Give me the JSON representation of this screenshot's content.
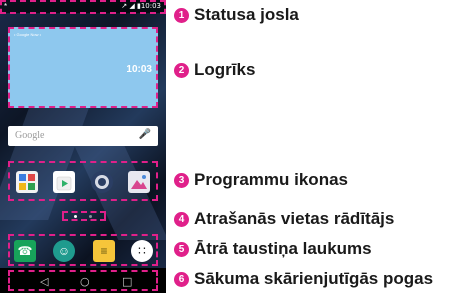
{
  "status_bar": {
    "left_icon": "*",
    "right_text": "↗ ◢ ▮10:03"
  },
  "widget": {
    "small_text": "• Google Now •",
    "time": "10:03"
  },
  "search": {
    "placeholder": "Google",
    "mic_icon": "microphone-icon"
  },
  "apps": [
    {
      "name": "apps-grid-icon",
      "color": "#f2f2f2"
    },
    {
      "name": "play-store-icon",
      "color": "#ffffff"
    },
    {
      "name": "camera-icon",
      "color": "#2b3e64"
    },
    {
      "name": "gallery-icon",
      "color": "#e8e8f0"
    }
  ],
  "quick_keys": [
    {
      "name": "phone-icon",
      "glyph": "☎",
      "color": "#17a35a"
    },
    {
      "name": "contacts-icon",
      "glyph": "☺",
      "color": "#1f9b8e"
    },
    {
      "name": "messaging-icon",
      "glyph": "≡",
      "color": "#f6c53a"
    },
    {
      "name": "apps-icon",
      "glyph": "∷",
      "color": "#ffffff"
    }
  ],
  "nav": {
    "back": "◁",
    "home": "○",
    "recent": "□"
  },
  "callouts": [
    {
      "number": "1",
      "label": "Statusa josla"
    },
    {
      "number": "2",
      "label": "Logrīks"
    },
    {
      "number": "3",
      "label": "Programmu ikonas"
    },
    {
      "number": "4",
      "label": "Atrašanās vietas rādītājs"
    },
    {
      "number": "5",
      "label": "Ātrā taustiņa laukums"
    },
    {
      "number": "6",
      "label": "Sākuma skārienjutīgās pogas"
    }
  ]
}
